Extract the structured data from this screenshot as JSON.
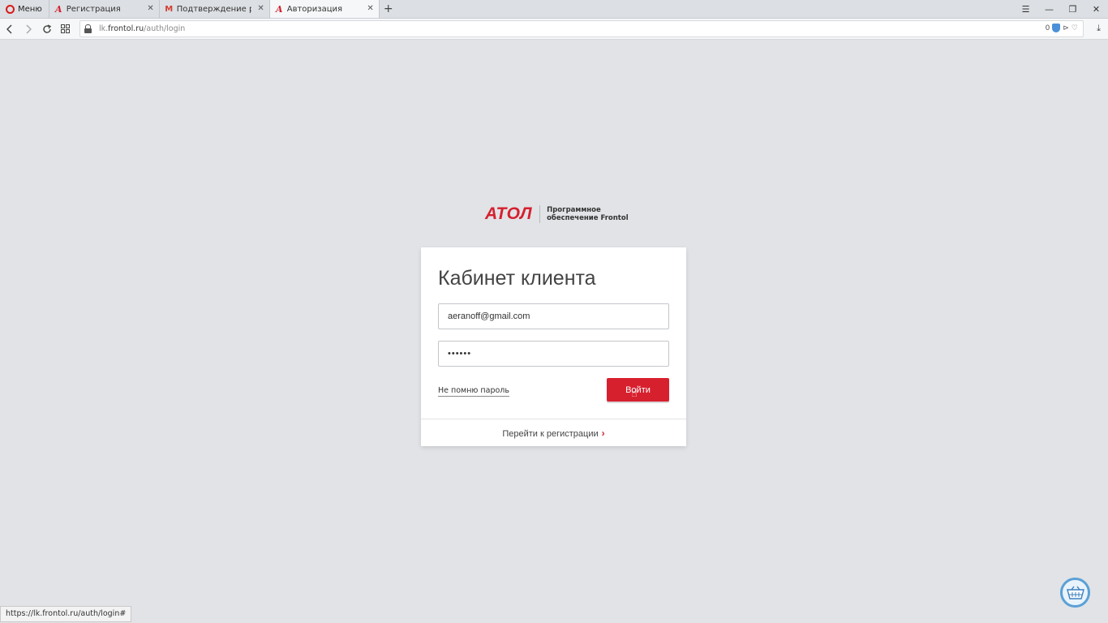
{
  "browser": {
    "menu_label": "Меню",
    "tabs": [
      {
        "title": "Регистрация",
        "favicon": "aton-icon"
      },
      {
        "title": "Подтверждение регистрации",
        "favicon": "gmail-icon"
      },
      {
        "title": "Авторизация",
        "favicon": "aton-icon",
        "active": true
      }
    ],
    "url": {
      "prefix": "lk.",
      "host": "frontol.ru",
      "path": "/auth/login"
    },
    "badge_count": "0"
  },
  "logo": {
    "mark": "АТОЛ",
    "caption_line1": "Программное",
    "caption_line2": "обеспечение Frontol"
  },
  "login": {
    "title": "Кабинет клиента",
    "email_value": "aeranoff@gmail.com",
    "password_value": "••••••",
    "forgot_label": "Не помню пароль",
    "submit_label": "Войти",
    "register_label": "Перейти к регистрации"
  },
  "status_bar": {
    "hover_url": "https://lk.frontol.ru/auth/login#"
  },
  "colors": {
    "accent": "#d7202e",
    "page_background": "#e1e3e6"
  }
}
